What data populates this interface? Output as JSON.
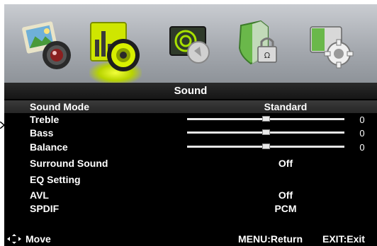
{
  "menu": {
    "tabs": [
      {
        "icon": "picture-icon"
      },
      {
        "icon": "sound-icon",
        "selected": true
      },
      {
        "icon": "channel-icon"
      },
      {
        "icon": "lock-icon"
      },
      {
        "icon": "setup-icon"
      }
    ],
    "title": "Sound"
  },
  "items": [
    {
      "label": "Sound Mode",
      "value": "Standard"
    },
    {
      "label": "Treble",
      "level": 0.5,
      "value": "0"
    },
    {
      "label": "Bass",
      "level": 0.5,
      "value": "0"
    },
    {
      "label": "Balance",
      "level": 0.5,
      "value": "0"
    },
    {
      "label": "Surround Sound",
      "value": "Off"
    },
    {
      "label": "EQ Setting"
    },
    {
      "label": "AVL",
      "value": "Off"
    },
    {
      "label": "SPDIF",
      "value": "PCM"
    }
  ],
  "footer": {
    "move": "Move",
    "menu": "MENU:Return",
    "exit": "EXIT:Exit"
  },
  "colors": {
    "glow": "#e8ff2a",
    "background": "#000000",
    "text": "#ffffff"
  }
}
